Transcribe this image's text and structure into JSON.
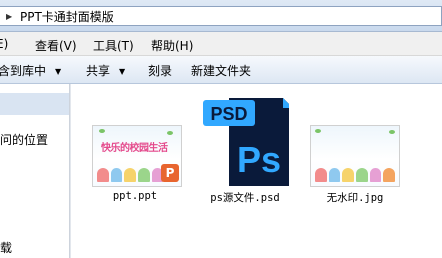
{
  "address_bar": {
    "path": "PPT卡通封面模版"
  },
  "menu": [
    {
      "label": "E)"
    },
    {
      "label": "查看(V)"
    },
    {
      "label": "工具(T)"
    },
    {
      "label": "帮助(H)"
    }
  ],
  "toolbar": {
    "include_in_library": "含到库中",
    "share": "共享",
    "burn": "刻录",
    "new_folder": "新建文件夹"
  },
  "nav": {
    "item_recent": "问的位置",
    "item_download": "载"
  },
  "files": [
    {
      "name": "ppt.ppt",
      "thumb_text": "快乐的校园生活"
    },
    {
      "name": "ps源文件.psd",
      "icon_text": "PSD",
      "app_text": "Ps"
    },
    {
      "name": "无水印.jpg"
    }
  ],
  "colors": {
    "ps_dark": "#0a1a3a",
    "ps_blue": "#31a8ff",
    "ppt_orange": "#e8652f"
  }
}
